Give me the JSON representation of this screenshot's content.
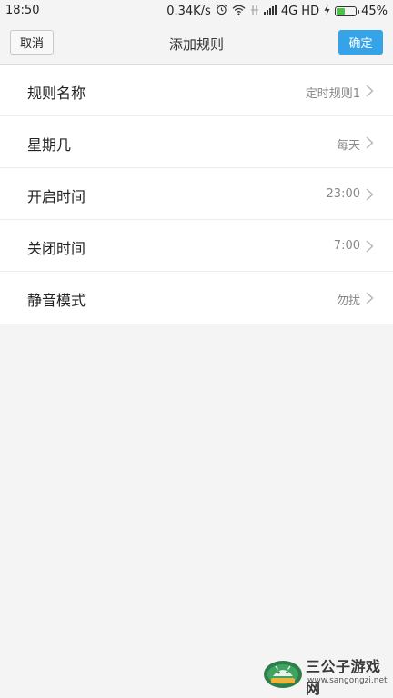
{
  "status_bar": {
    "time": "18:50",
    "speed": "0.34K/s",
    "network": "4G HD",
    "battery_percent": "45%",
    "battery_level": 0.45,
    "icons": [
      "alarm-icon",
      "wifi-icon",
      "no-signal-icon",
      "signal-icon",
      "charging-icon",
      "battery-icon"
    ]
  },
  "header": {
    "cancel_label": "取消",
    "title": "添加规则",
    "confirm_label": "确定",
    "confirm_color": "#35a3e8"
  },
  "rule_settings": [
    {
      "label": "规则名称",
      "value": "定时规则1"
    },
    {
      "label": "星期几",
      "value": "每天"
    },
    {
      "label": "开启时间",
      "value": "23:00"
    },
    {
      "label": "关闭时间",
      "value": "7:00"
    },
    {
      "label": "静音模式",
      "value": "勿扰"
    }
  ],
  "watermark": {
    "name": "三公子游戏网",
    "url": "www.sangongzi.net"
  }
}
